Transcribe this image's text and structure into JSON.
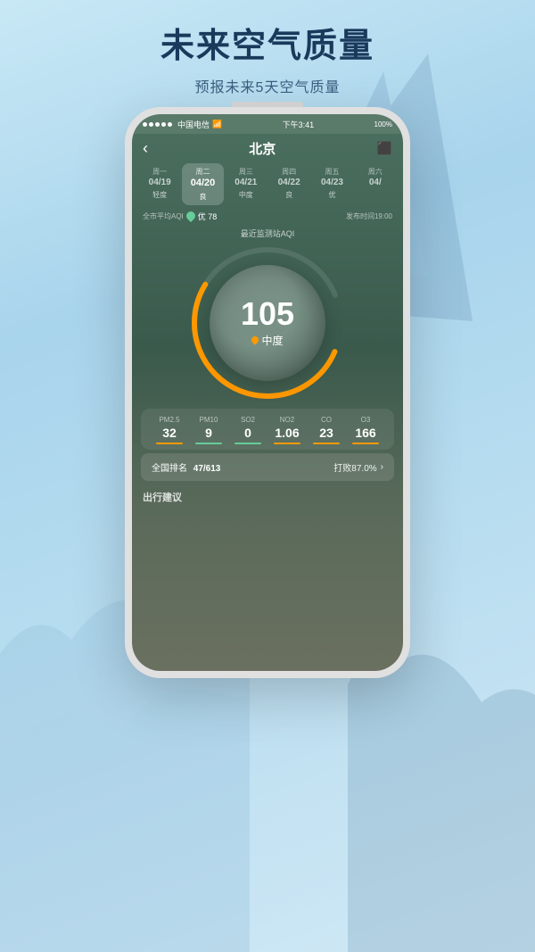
{
  "page": {
    "background_color": "#b8ddf5",
    "title": "未来空气质量",
    "subtitle": "预报未来5天空气质量"
  },
  "phone": {
    "status_bar": {
      "carrier": "中国电信",
      "wifi": "WiFi",
      "time": "下午3:41",
      "battery": "100%"
    },
    "nav": {
      "back": "‹",
      "title": "北京",
      "share": "⬡"
    },
    "days": [
      {
        "name": "周一",
        "date": "04/19",
        "quality": "轻度",
        "active": false
      },
      {
        "name": "周二",
        "date": "04/20",
        "quality": "良",
        "active": true
      },
      {
        "name": "周三",
        "date": "04/21",
        "quality": "中度",
        "active": false
      },
      {
        "name": "周四",
        "date": "04/22",
        "quality": "良",
        "active": false
      },
      {
        "name": "周五",
        "date": "04/23",
        "quality": "优",
        "active": false
      },
      {
        "name": "周六",
        "date": "04/",
        "quality": "",
        "active": false
      }
    ],
    "aqi_info": {
      "label": "全市平均AQI",
      "value": "优 78",
      "publish_time": "发布时间19:00"
    },
    "gauge": {
      "label": "最近监测站AQI",
      "value": "105",
      "quality": "中度"
    },
    "pollutants": [
      {
        "name": "PM2.5",
        "value": "32",
        "color": "#f90"
      },
      {
        "name": "PM10",
        "value": "9",
        "color": "#6c9"
      },
      {
        "name": "SO2",
        "value": "0",
        "color": "#6c9"
      },
      {
        "name": "NO2",
        "value": "1.06",
        "color": "#f90"
      },
      {
        "name": "CO",
        "value": "23",
        "color": "#f90"
      },
      {
        "name": "O3",
        "value": "166",
        "color": "#f90"
      }
    ],
    "ranking": {
      "label": "全国排名",
      "rank": "47/613",
      "beat": "打败87.0%",
      "chevron": "›"
    },
    "travel_advice": {
      "label": "出行建议"
    }
  }
}
